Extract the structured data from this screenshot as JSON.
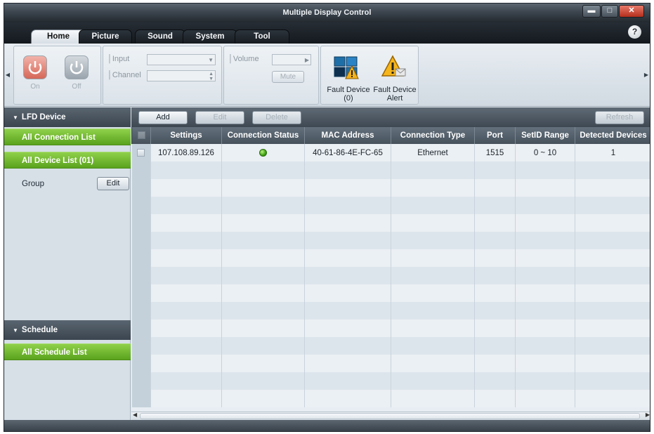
{
  "window": {
    "title": "Multiple Display Control",
    "minimize_icon": "minimize-icon",
    "maximize_icon": "maximize-icon",
    "close_icon": "close-icon",
    "minimize_glyph": "▬",
    "maximize_glyph": "□",
    "close_glyph": "✕"
  },
  "tabs": [
    {
      "label": "Home",
      "active": true
    },
    {
      "label": "Picture",
      "active": false
    },
    {
      "label": "Sound",
      "active": false
    },
    {
      "label": "System",
      "active": false
    },
    {
      "label": "Tool",
      "active": false
    }
  ],
  "help_glyph": "?",
  "ribbon": {
    "left_arrow": "◀",
    "right_arrow": "▶",
    "on_label": "On",
    "off_label": "Off",
    "input_label": "Input",
    "channel_label": "Channel",
    "input_value": "",
    "channel_value": "",
    "volume_label": "Volume",
    "volume_value": "",
    "mute_label": "Mute",
    "fault_device_label": "Fault Device",
    "fault_device_count": "(0)",
    "fault_alert_label": "Fault Device",
    "fault_alert_label2": "Alert"
  },
  "sidebar": {
    "lfd_header": "LFD Device",
    "all_connection_list": "All Connection List",
    "all_device_list": "All Device List (01)",
    "group_label": "Group",
    "group_edit": "Edit",
    "schedule_header": "Schedule",
    "all_schedule_list": "All Schedule List",
    "collapse_glyph": "▼"
  },
  "toolbar": {
    "add": "Add",
    "edit": "Edit",
    "delete": "Delete",
    "refresh": "Refresh"
  },
  "table": {
    "columns": [
      "Settings",
      "Connection Status",
      "MAC Address",
      "Connection Type",
      "Port",
      "SetID Range",
      "Detected Devices"
    ],
    "rows": [
      {
        "settings": "107.108.89.126",
        "status": "connected",
        "status_color": "#3da012",
        "mac": "40-61-86-4E-FC-65",
        "type": "Ethernet",
        "port": "1515",
        "setid": "0 ~ 10",
        "detected": "1"
      }
    ]
  },
  "colors": {
    "accent_green": "#5aa31d",
    "header_dark": "#46515b",
    "power_on": "#e0685a"
  }
}
